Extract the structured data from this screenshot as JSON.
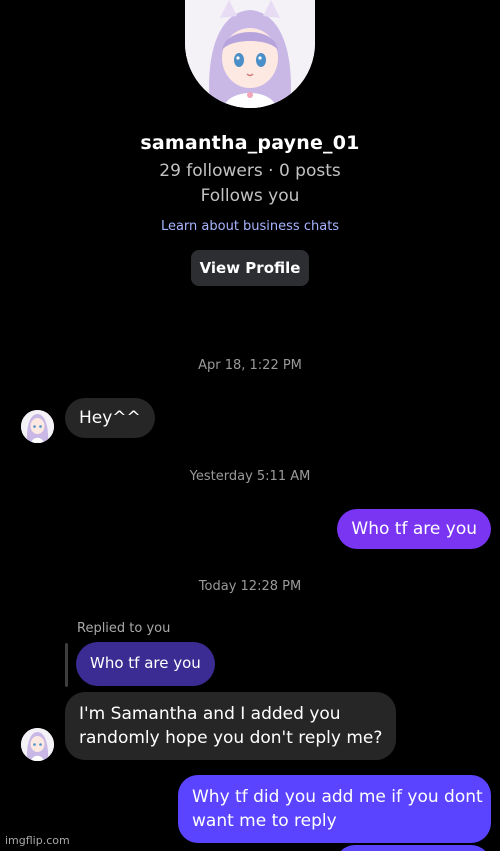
{
  "profile": {
    "username": "samantha_payne_01",
    "stats": "29 followers · 0 posts",
    "follows_status": "Follows you",
    "learn_link": "Learn about business chats",
    "view_profile_label": "View Profile"
  },
  "conversation": {
    "ts1": "Apr 18, 1:22 PM",
    "msg1": "Hey^^",
    "ts2": "Yesterday 5:11 AM",
    "msg2": "Who tf are you",
    "ts3": "Today 12:28 PM",
    "replied_label": "Replied to you",
    "reply_quote": "Who tf are you",
    "msg3_line1": "I'm Samantha and I added you",
    "msg3_line2": "randomly hope you don't reply me?",
    "msg4_line1": "Why tf did you add me if you dont",
    "msg4_line2": "want me to reply"
  },
  "watermark": "imgflip.com",
  "colors": {
    "background": "#000000",
    "incoming_bubble": "#262626",
    "outgoing_bubble": "#7a35f2",
    "reply_quote_bubble": "#3a2c93",
    "link": "#a7b4ff"
  },
  "icons": {
    "profile_avatar": "anime-girl-avatar"
  }
}
